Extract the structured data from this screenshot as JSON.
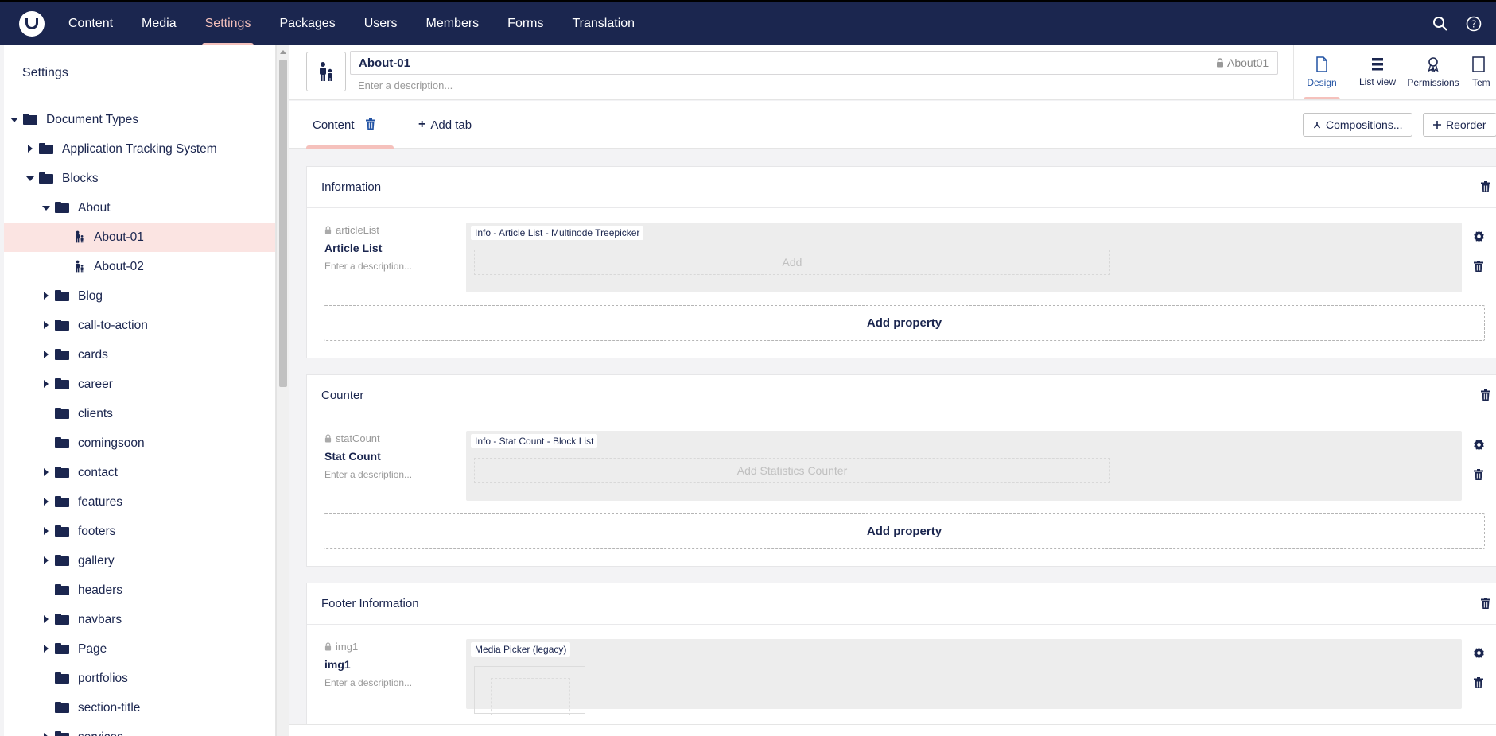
{
  "topbar": {
    "nav": [
      "Content",
      "Media",
      "Settings",
      "Packages",
      "Users",
      "Members",
      "Forms",
      "Translation"
    ],
    "active": "Settings"
  },
  "sidebar": {
    "title": "Settings",
    "tree": [
      {
        "label": "Document Types",
        "depth": 0,
        "caret": "down",
        "icon": "folder-icon"
      },
      {
        "label": "Application Tracking System",
        "depth": 1,
        "caret": "right",
        "icon": "folder-icon"
      },
      {
        "label": "Blocks",
        "depth": 1,
        "caret": "down",
        "icon": "folder-icon"
      },
      {
        "label": "About",
        "depth": 2,
        "caret": "down",
        "icon": "folder-icon"
      },
      {
        "label": "About-01",
        "depth": 3,
        "caret": "",
        "icon": "doc-type-icon",
        "selected": true
      },
      {
        "label": "About-02",
        "depth": 3,
        "caret": "",
        "icon": "doc-type-icon"
      },
      {
        "label": "Blog",
        "depth": 2,
        "caret": "right",
        "icon": "folder-icon"
      },
      {
        "label": "call-to-action",
        "depth": 2,
        "caret": "right",
        "icon": "folder-icon"
      },
      {
        "label": "cards",
        "depth": 2,
        "caret": "right",
        "icon": "folder-icon"
      },
      {
        "label": "career",
        "depth": 2,
        "caret": "right",
        "icon": "folder-icon"
      },
      {
        "label": "clients",
        "depth": 2,
        "caret": "",
        "icon": "folder-icon"
      },
      {
        "label": "comingsoon",
        "depth": 2,
        "caret": "",
        "icon": "folder-icon"
      },
      {
        "label": "contact",
        "depth": 2,
        "caret": "right",
        "icon": "folder-icon"
      },
      {
        "label": "features",
        "depth": 2,
        "caret": "right",
        "icon": "folder-icon"
      },
      {
        "label": "footers",
        "depth": 2,
        "caret": "right",
        "icon": "folder-icon"
      },
      {
        "label": "gallery",
        "depth": 2,
        "caret": "right",
        "icon": "folder-icon"
      },
      {
        "label": "headers",
        "depth": 2,
        "caret": "",
        "icon": "folder-icon"
      },
      {
        "label": "navbars",
        "depth": 2,
        "caret": "right",
        "icon": "folder-icon"
      },
      {
        "label": "Page",
        "depth": 2,
        "caret": "right",
        "icon": "folder-icon"
      },
      {
        "label": "portfolios",
        "depth": 2,
        "caret": "",
        "icon": "folder-icon"
      },
      {
        "label": "section-title",
        "depth": 2,
        "caret": "",
        "icon": "folder-icon"
      },
      {
        "label": "services",
        "depth": 2,
        "caret": "right",
        "icon": "folder-icon"
      }
    ]
  },
  "header": {
    "name": "About-01",
    "alias": "About01",
    "description_placeholder": "Enter a description...",
    "apps": [
      {
        "label": "Design",
        "icon": "document-icon",
        "active": true
      },
      {
        "label": "List view",
        "icon": "list-icon"
      },
      {
        "label": "Permissions",
        "icon": "ribbon-icon"
      },
      {
        "label": "Tem",
        "icon": "template-icon"
      }
    ]
  },
  "tabs": {
    "content_tab": "Content",
    "add_tab": "Add tab",
    "compositions": "Compositions...",
    "reorder": "Reorder"
  },
  "groups": [
    {
      "name": "Information",
      "property": {
        "alias": "articleList",
        "label": "Article List",
        "description": "Enter a description...",
        "editor": "Info - Article List - Multinode Treepicker",
        "add_label": "Add"
      },
      "add_property": "Add property"
    },
    {
      "name": "Counter",
      "property": {
        "alias": "statCount",
        "label": "Stat Count",
        "description": "Enter a description...",
        "editor": "Info - Stat Count - Block List",
        "add_label": "Add Statistics Counter"
      },
      "add_property": "Add property"
    },
    {
      "name": "Footer Information",
      "property": {
        "alias": "img1",
        "label": "img1",
        "description": "Enter a description...",
        "editor": "Media Picker (legacy)"
      }
    }
  ],
  "colors": {
    "topbar": "#1b264f",
    "accent": "#f5c1bc",
    "selected_row": "#fbe4e2"
  }
}
